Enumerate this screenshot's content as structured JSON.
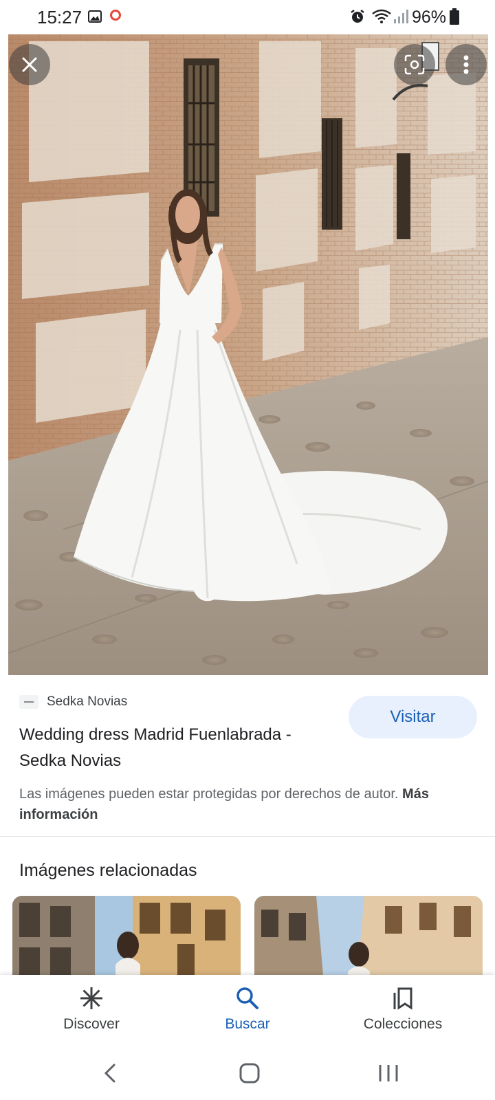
{
  "status_bar": {
    "time": "15:27",
    "battery": "96%",
    "icons": [
      "gallery-icon",
      "ring-icon",
      "alarm-icon",
      "wifi-icon",
      "signal-icon",
      "battery-icon"
    ]
  },
  "viewer": {
    "close_icon": "close-icon",
    "lens_icon": "lens-icon",
    "more_icon": "more-vert-icon"
  },
  "result": {
    "source_name": "Sedka Novias",
    "title": "Wedding dress Madrid Fuenlabrada - Sedka Novias",
    "visit_label": "Visitar",
    "copyright_text": "Las imágenes pueden estar protegidas por derechos de autor.",
    "more_info": "Más información"
  },
  "related": {
    "heading": "Imágenes relacionadas"
  },
  "bottom_nav": {
    "items": [
      {
        "label": "Discover",
        "icon": "asterisk-icon",
        "active": false
      },
      {
        "label": "Buscar",
        "icon": "search-icon",
        "active": true
      },
      {
        "label": "Colecciones",
        "icon": "collections-icon",
        "active": false
      }
    ]
  },
  "colors": {
    "accent": "#1a5fb4",
    "visit_bg": "#e8f0fe",
    "recording_dot": "#e8453c"
  }
}
